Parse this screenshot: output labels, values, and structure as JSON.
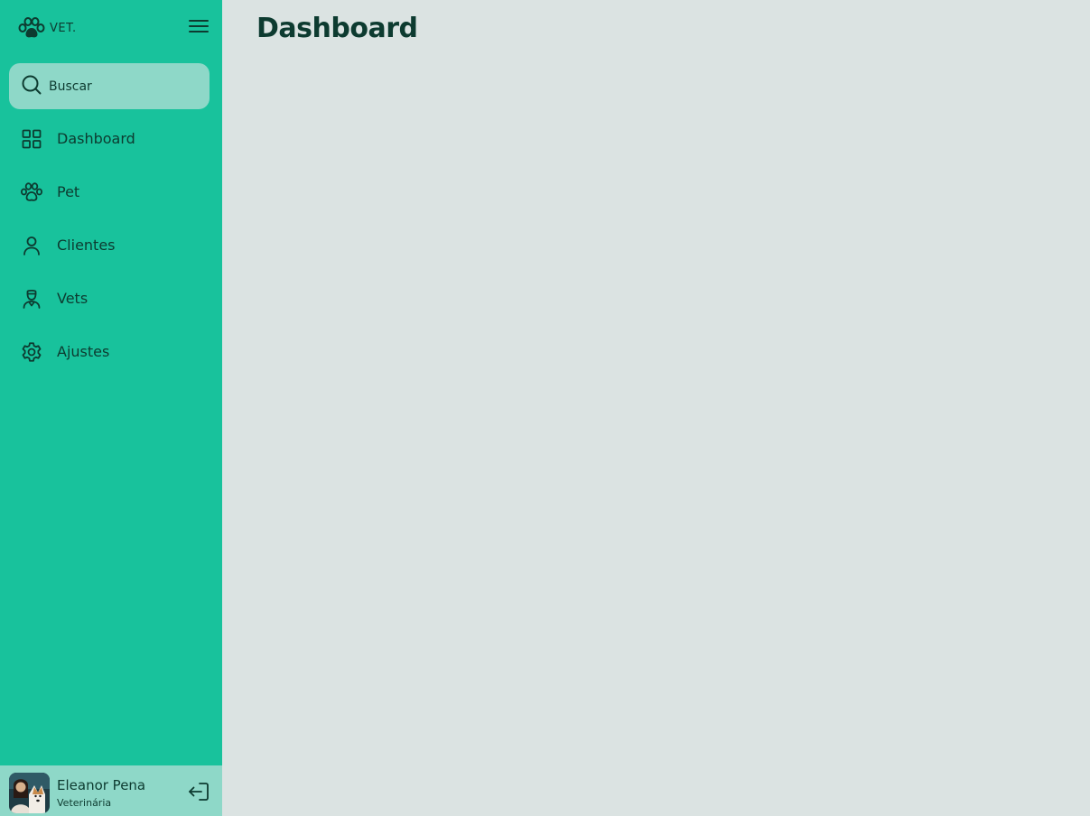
{
  "brand": {
    "name": "VET.",
    "logo_icon": "paw-icon"
  },
  "search": {
    "placeholder": "Buscar",
    "icon": "search-icon"
  },
  "nav": {
    "items": [
      {
        "label": "Dashboard",
        "icon": "dashboard-grid-icon"
      },
      {
        "label": "Pet",
        "icon": "paw-icon"
      },
      {
        "label": "Clientes",
        "icon": "user-icon"
      },
      {
        "label": "Vets",
        "icon": "vet-doctor-icon"
      },
      {
        "label": "Ajustes",
        "icon": "gear-icon"
      }
    ]
  },
  "user": {
    "name": "Eleanor Pena",
    "role": "Veterinária",
    "logout_icon": "logout-icon"
  },
  "main": {
    "title": "Dashboard"
  },
  "colors": {
    "sidebar": "#18c29c",
    "accent_light": "#8ed8c8",
    "background": "#dbe3e2",
    "text_dark": "#0d3b30"
  }
}
